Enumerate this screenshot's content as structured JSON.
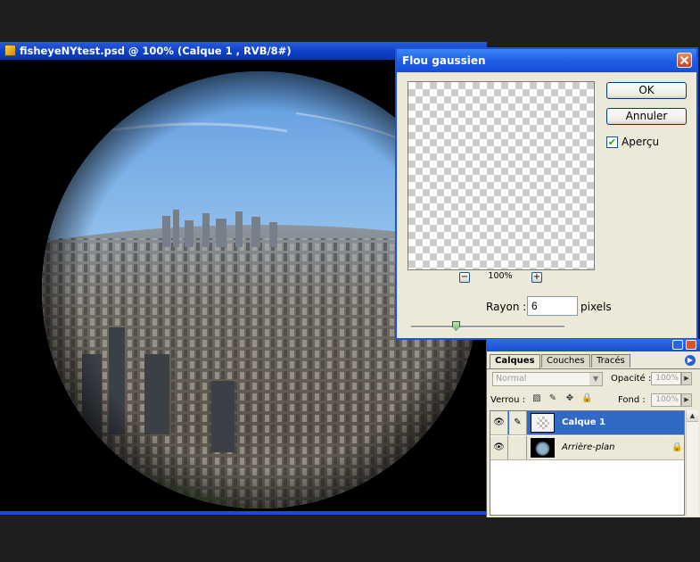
{
  "document": {
    "title": "fisheyeNYtest.psd @ 100% (Calque 1 , RVB/8#)"
  },
  "dialog": {
    "title": "Flou gaussien",
    "ok_label": "OK",
    "cancel_label": "Annuler",
    "preview_label": "Aperçu",
    "preview_checked": true,
    "zoom_level": "100%",
    "zoom_minus": "−",
    "zoom_plus": "+",
    "radius_label": "Rayon :",
    "radius_value": "6",
    "radius_unit": "pixels"
  },
  "layers_panel": {
    "tabs": [
      "Calques",
      "Couches",
      "Tracés"
    ],
    "blend_mode": "Normal",
    "opacity_label": "Opacité :",
    "opacity_value": "100%",
    "lock_label": "Verrou :",
    "fill_label": "Fond :",
    "fill_value": "100%",
    "layers": [
      {
        "name": "Calque 1",
        "selected": true
      },
      {
        "name": "Arrière-plan",
        "selected": false,
        "locked": true
      }
    ]
  },
  "colors": {
    "title_bar_blue": "#0c3ec4",
    "dialog_face": "#ece9d8",
    "selection_blue": "#316ac5",
    "close_red": "#c9421e"
  }
}
